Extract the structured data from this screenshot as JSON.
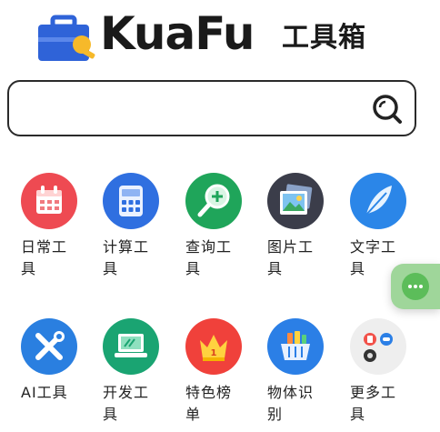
{
  "header": {
    "logo_text": "KuaFu",
    "logo_suffix": "工具箱"
  },
  "search": {
    "placeholder": "",
    "value": ""
  },
  "tools": [
    {
      "label": "日常工具",
      "icon": "calendar-icon",
      "color": "#ee4a52"
    },
    {
      "label": "计算工具",
      "icon": "calculator-icon",
      "color": "#2f6fe0"
    },
    {
      "label": "查询工具",
      "icon": "magnifier-plus-icon",
      "color": "#1fa55a"
    },
    {
      "label": "图片工具",
      "icon": "picture-icon",
      "color": "#3b3d4a"
    },
    {
      "label": "文字工具",
      "icon": "feather-icon",
      "color": "#2b86e8"
    },
    {
      "label": "AI工具",
      "icon": "wrench-screwdriver-icon",
      "color": "#2a7fe0"
    },
    {
      "label": "开发工具",
      "icon": "laptop-icon",
      "color": "#1aa472"
    },
    {
      "label": "特色榜单",
      "icon": "crown-icon",
      "color": "#f0413b"
    },
    {
      "label": "物体识别",
      "icon": "basket-icon",
      "color": "#2b7fe6"
    },
    {
      "label": "更多工具",
      "icon": "apps-grid-icon",
      "color": "#eeeeee"
    }
  ],
  "floating": {
    "icon": "more-dots-icon",
    "color": "#9fd69a"
  }
}
